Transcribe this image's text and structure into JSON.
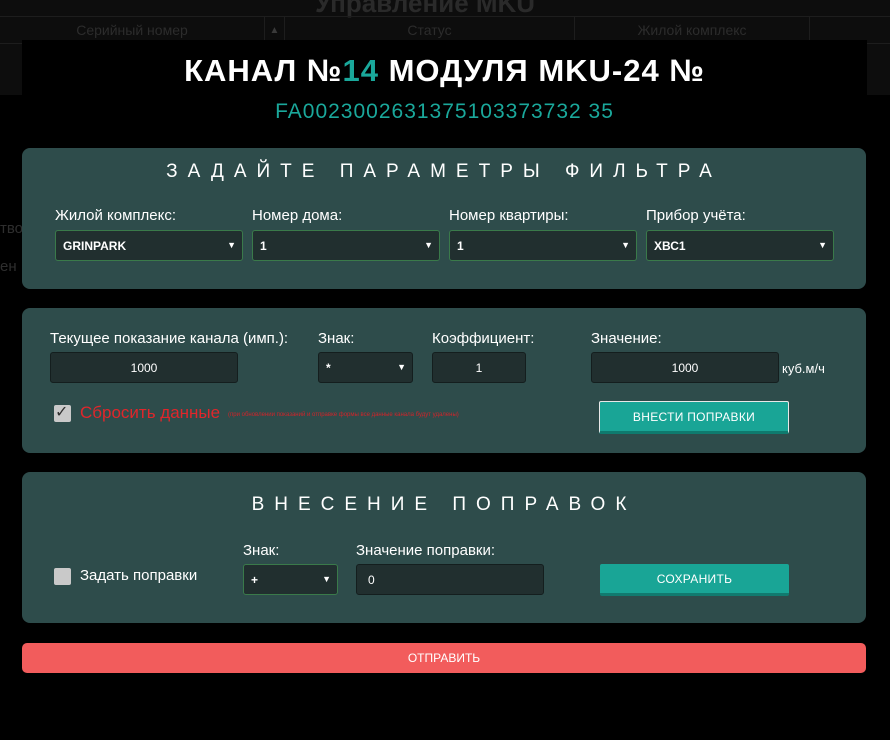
{
  "background": {
    "page_title": "Управление MKU",
    "table_headers": [
      "Серийный номер",
      "",
      "Статус",
      "Жилой комплекс",
      ""
    ],
    "side_text_1": "тво",
    "side_text_2": "ен"
  },
  "modal": {
    "title_prefix": "КАНАЛ №",
    "channel_number": "14",
    "title_suffix": " МОДУЛЯ MKU-24 №",
    "serial": "FA0023002631375103373732 35"
  },
  "filter": {
    "heading": "ЗАДАЙТЕ ПАРАМЕТРЫ ФИЛЬТРА",
    "fields": [
      {
        "label": "Жилой комплекс:",
        "value": "GRINPARK"
      },
      {
        "label": "Номер дома:",
        "value": "1"
      },
      {
        "label": "Номер квартиры:",
        "value": "1"
      },
      {
        "label": "Прибор учёта:",
        "value": "ХВС1"
      }
    ]
  },
  "channel": {
    "current_label": "Текущее показание канала (имп.):",
    "current_value": "1000",
    "sign_label": "Знак:",
    "sign_value": "*",
    "coef_label": "Коэффициент:",
    "coef_value": "1",
    "value_label": "Значение:",
    "value_value": "1000",
    "unit": "куб.м/ч",
    "reset_checked": true,
    "reset_label": "Сбросить данные",
    "reset_note": "(при обнов­лении показа­ний и отправке формы все данные канала будут удалены)",
    "apply_button": "ВНЕСТИ ПОПРАВКИ"
  },
  "correction": {
    "heading": "ВНЕСЕНИЕ ПОПРАВОК",
    "checkbox_label": "Задать поправки",
    "checkbox_checked": false,
    "sign_label": "Знак:",
    "sign_value": "+",
    "value_label": "Значение поправки:",
    "value_value": "0",
    "save_button": "СОХРАНИТЬ"
  },
  "submit_button": "ОТПРАВИТЬ",
  "colors": {
    "accent": "#1aa89b",
    "panel": "#2e4c4b",
    "submit": "#f25c5c",
    "danger_text": "#e0262b"
  }
}
